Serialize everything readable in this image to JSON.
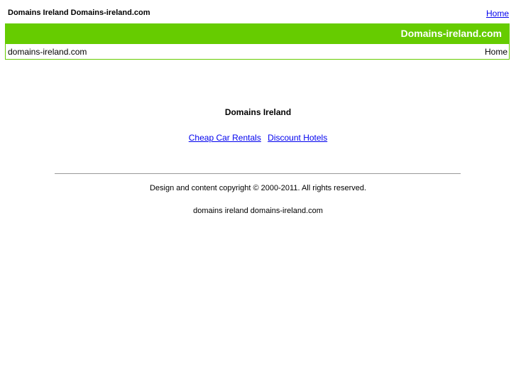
{
  "topbar": {
    "site_title": "Domains Ireland Domains-ireland.com",
    "home_link": "Home"
  },
  "header": {
    "brand": "Domains-ireland.com",
    "domain": "domains-ireland.com",
    "nav_home": "Home",
    "accent_color": "#66cc00"
  },
  "main": {
    "heading": "Domains Ireland",
    "links": [
      {
        "label": "Cheap Car Rentals"
      },
      {
        "label": "Discount Hotels"
      }
    ]
  },
  "footer": {
    "copyright": "Design and content copyright © 2000-2011. All rights reserved.",
    "text": "domains ireland domains-ireland.com"
  }
}
